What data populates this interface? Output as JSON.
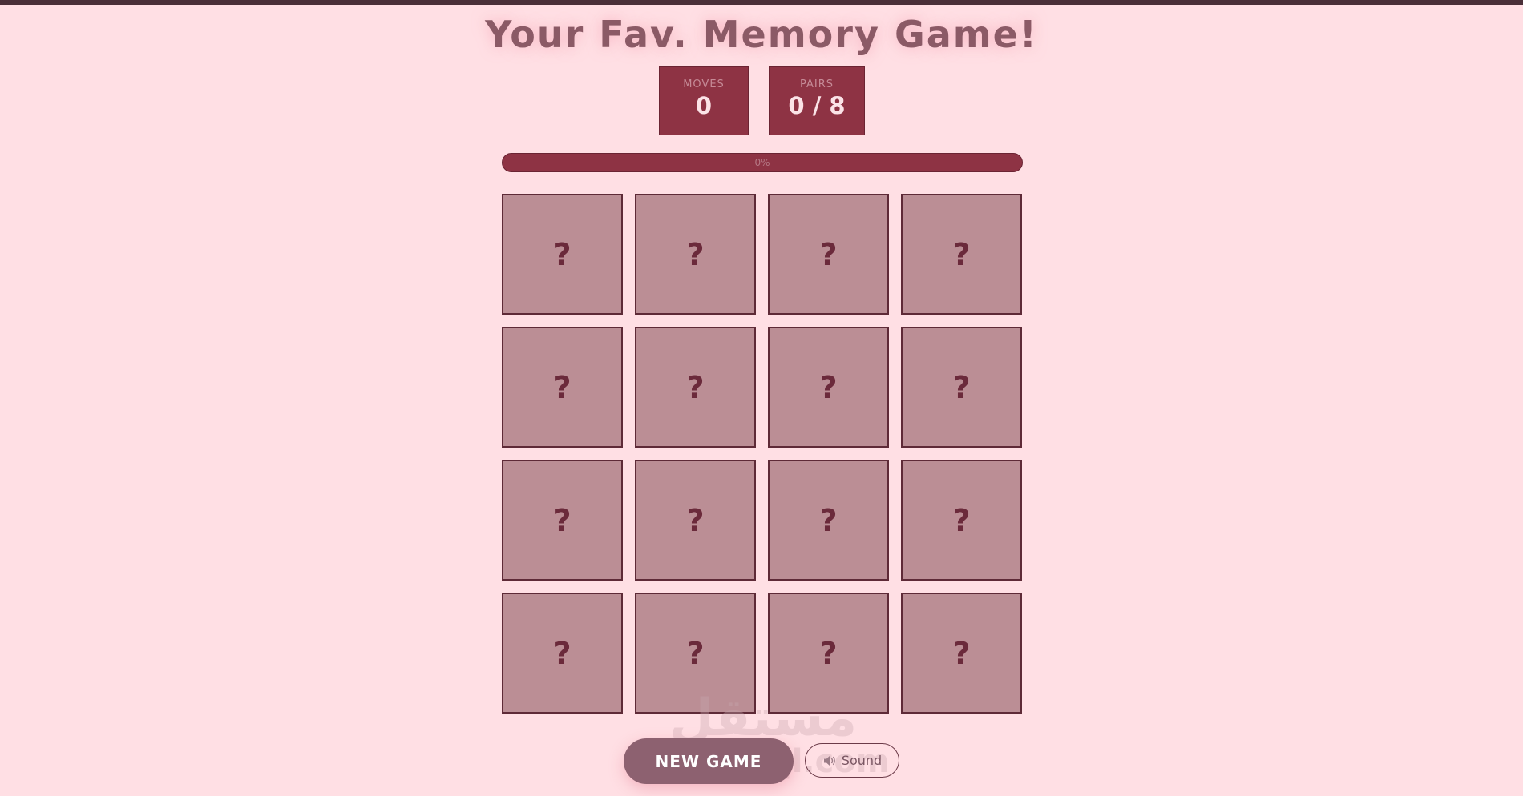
{
  "title": "Your Fav. Memory Game!",
  "stats": {
    "moves_label": "MOVES",
    "moves_value": "0",
    "pairs_label": "PAIRS",
    "pairs_value": "0 / 8"
  },
  "progress": {
    "text": "0%",
    "value_percent": 0
  },
  "cards": [
    "?",
    "?",
    "?",
    "?",
    "?",
    "?",
    "?",
    "?",
    "?",
    "?",
    "?",
    "?",
    "?",
    "?",
    "?",
    "?"
  ],
  "controls": {
    "new_game_label": "NEW GAME",
    "sound_label": "Sound",
    "sound_icon": "speaker-icon"
  },
  "watermark": {
    "arabic": "مستقل",
    "latin": "mostaql.com"
  },
  "colors": {
    "background": "#ffdfe4",
    "accent": "#8e3344",
    "card_back": "#bb8e95",
    "title": "#8b5a66"
  }
}
